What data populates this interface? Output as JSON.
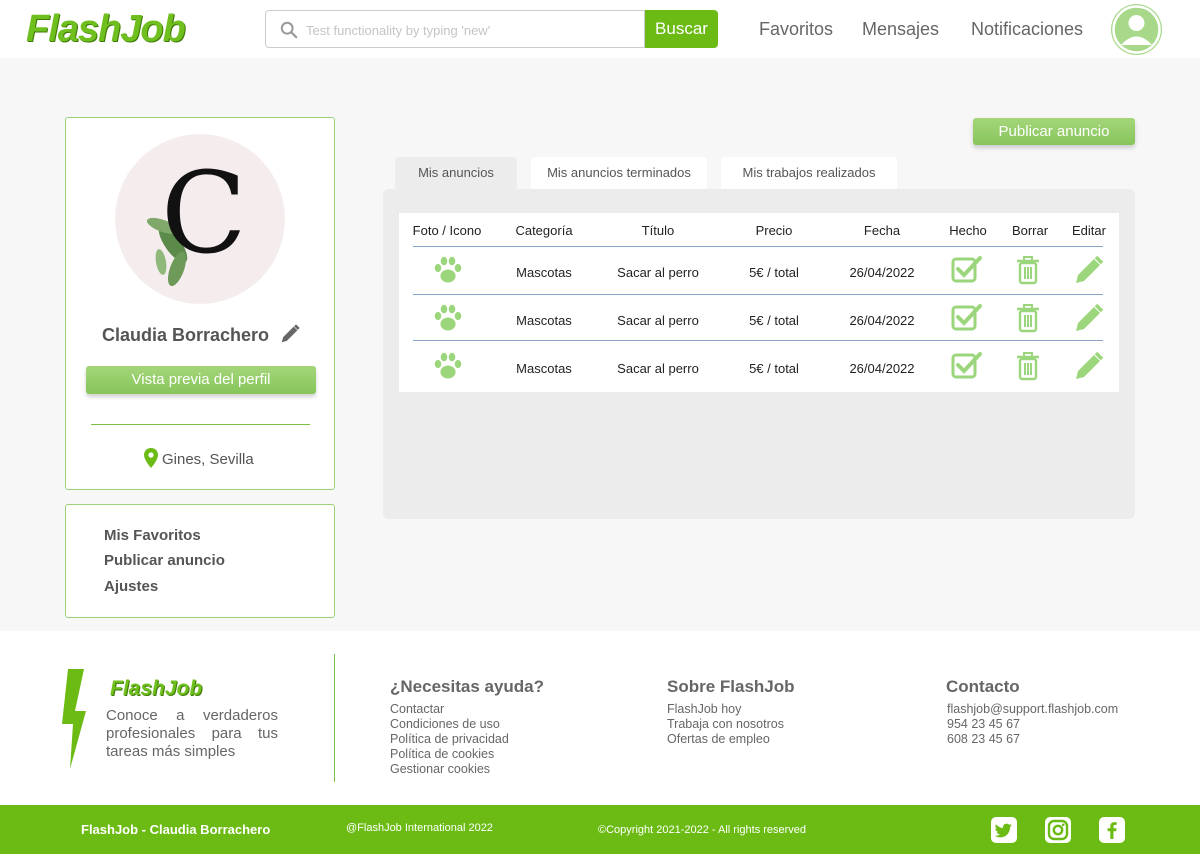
{
  "header": {
    "logo": "FlashJob",
    "search_placeholder": "Test functionality by typing 'new'",
    "search_button": "Buscar",
    "nav": [
      "Favoritos",
      "Mensajes",
      "Notificaciones"
    ]
  },
  "profile": {
    "initial": "C",
    "name": "Claudia Borrachero",
    "preview_button": "Vista previa del perfil",
    "location": "Gines, Sevilla"
  },
  "menu": [
    "Mis Favoritos",
    "Publicar anuncio",
    "Ajustes"
  ],
  "main": {
    "publish_button": "Publicar anuncio",
    "tabs": [
      "Mis anuncios",
      "Mis anuncios terminados",
      "Mis trabajos realizados"
    ],
    "active_tab": "Mis anuncios",
    "columns": [
      "Foto / Icono",
      "Categoría",
      "Título",
      "Precio",
      "Fecha",
      "Hecho",
      "Borrar",
      "Editar"
    ],
    "rows": [
      {
        "icon": "paw-icon",
        "category": "Mascotas",
        "title": "Sacar al perro",
        "price": "5€ / total",
        "date": "26/04/2022"
      },
      {
        "icon": "paw-icon",
        "category": "Mascotas",
        "title": "Sacar al perro",
        "price": "5€ / total",
        "date": "26/04/2022"
      },
      {
        "icon": "paw-icon",
        "category": "Mascotas",
        "title": "Sacar al perro",
        "price": "5€ / total",
        "date": "26/04/2022"
      }
    ]
  },
  "footer": {
    "logo": "FlashJob",
    "tagline": "Conoce a verdaderos profesionales para tus tareas más simples",
    "help": {
      "title": "¿Necesitas ayuda?",
      "links": [
        "Contactar",
        "Condiciones de uso",
        "Política de privacidad",
        "Política de cookies",
        "Gestionar cookies"
      ]
    },
    "about": {
      "title": "Sobre FlashJob",
      "links": [
        "FlashJob hoy",
        "Trabaja con nosotros",
        "Ofertas de empleo"
      ]
    },
    "contact": {
      "title": "Contacto",
      "links": [
        "flashjob@support.flashjob.com",
        "954 23 45 67",
        "608 23 45 67"
      ]
    },
    "bottom": {
      "left": "FlashJob - Claudia Borrachero",
      "center": "@FlashJob International 2022",
      "right": "©Copyright  2021-2022 - All rights reserved"
    }
  },
  "colors": {
    "brand_green": "#6cbb14",
    "light_green": "#a5d67a",
    "icon_green": "#9bd67c"
  }
}
